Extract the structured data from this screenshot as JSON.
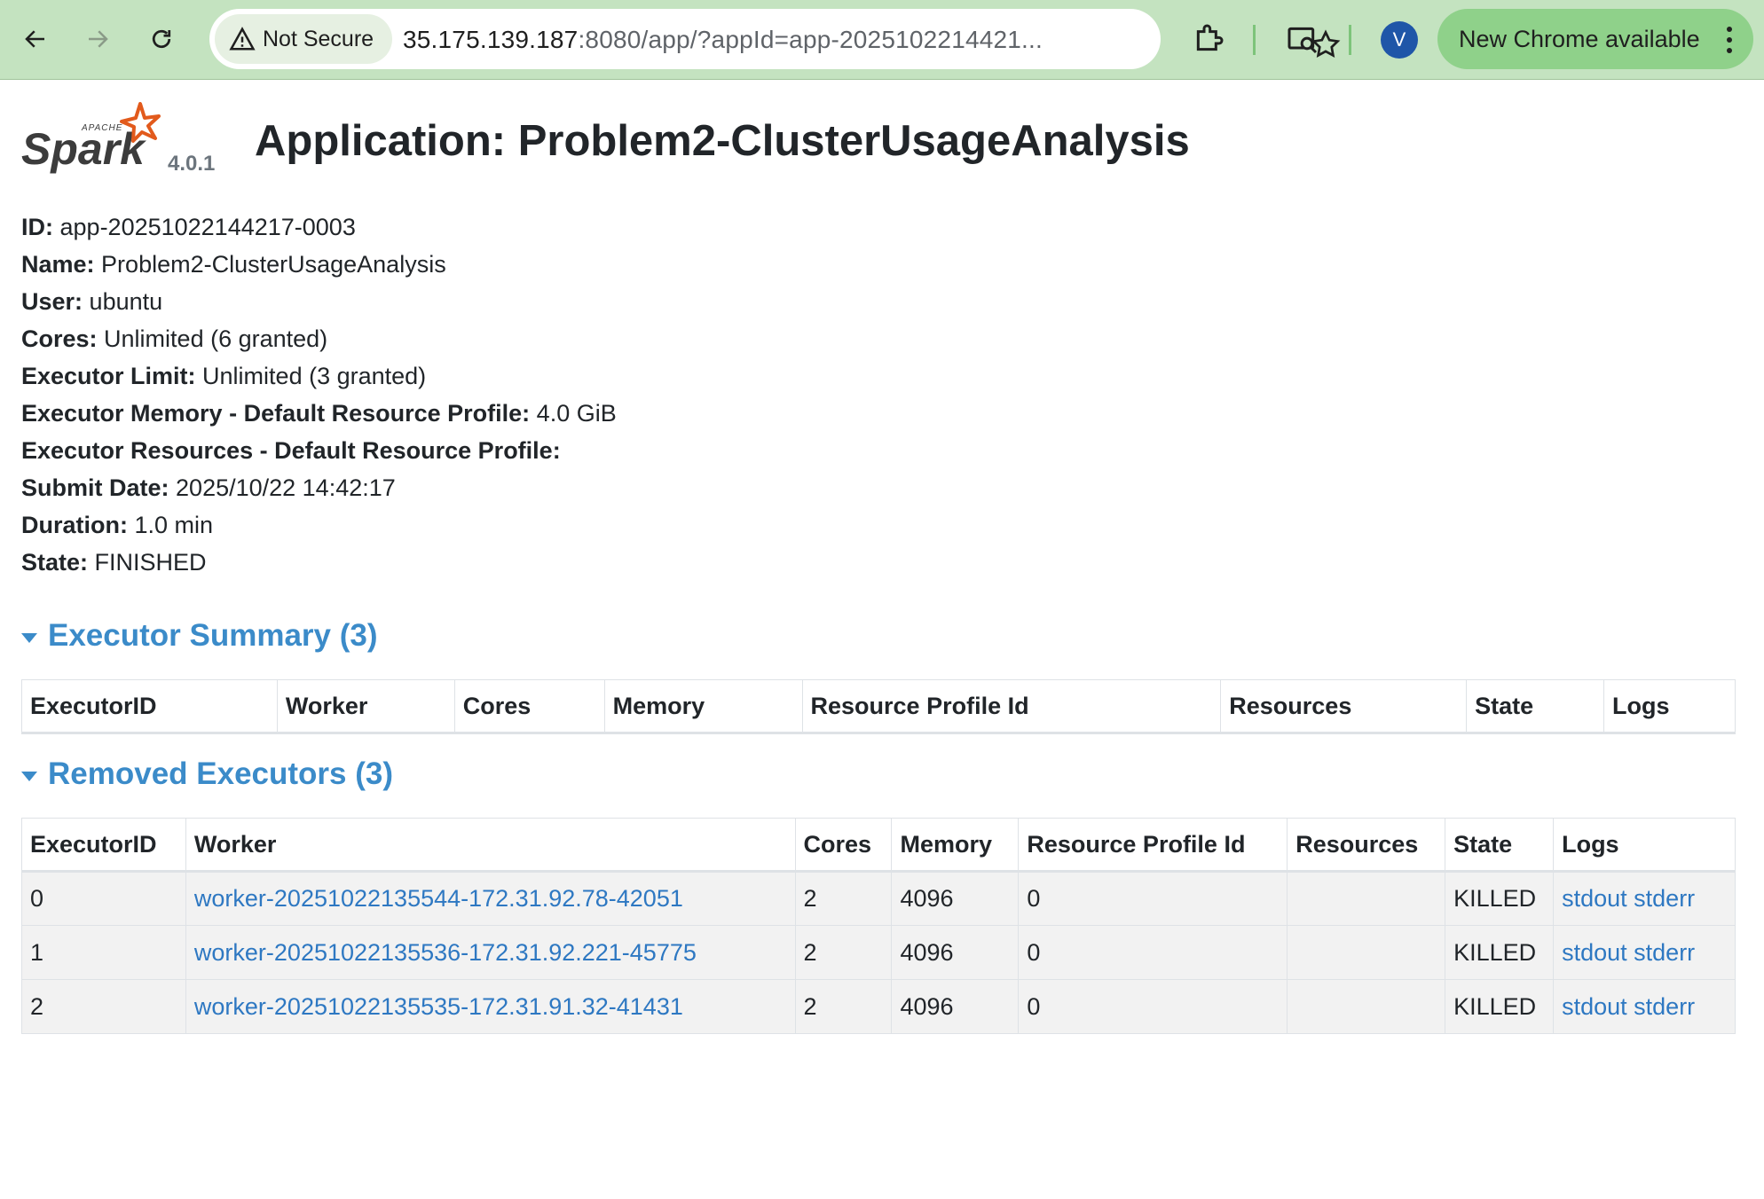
{
  "browser": {
    "security_label": "Not Secure",
    "url_host": "35.175.139.187",
    "url_rest": ":8080/app/?appId=app-2025102214421...",
    "avatar_initial": "V",
    "update_label": "New Chrome available"
  },
  "header": {
    "logo_text": "Spark",
    "logo_subtext": "APACHE",
    "version": "4.0.1",
    "title": "Application: Problem2-ClusterUsageAnalysis"
  },
  "info": [
    {
      "label": "ID:",
      "value": "app-20251022144217-0003"
    },
    {
      "label": "Name:",
      "value": "Problem2-ClusterUsageAnalysis"
    },
    {
      "label": "User:",
      "value": "ubuntu"
    },
    {
      "label": "Cores:",
      "value": "Unlimited (6 granted)"
    },
    {
      "label": "Executor Limit:",
      "value": "Unlimited (3 granted)"
    },
    {
      "label": "Executor Memory - Default Resource Profile:",
      "value": "4.0 GiB"
    },
    {
      "label": "Executor Resources - Default Resource Profile:",
      "value": ""
    },
    {
      "label": "Submit Date:",
      "value": "2025/10/22 14:42:17"
    },
    {
      "label": "Duration:",
      "value": "1.0 min"
    },
    {
      "label": "State:",
      "value": "FINISHED"
    }
  ],
  "executor_summary": {
    "title": "Executor Summary (3)",
    "columns": [
      "ExecutorID",
      "Worker",
      "Cores",
      "Memory",
      "Resource Profile Id",
      "Resources",
      "State",
      "Logs"
    ]
  },
  "removed_executors": {
    "title": "Removed Executors (3)",
    "columns": [
      "ExecutorID",
      "Worker",
      "Cores",
      "Memory",
      "Resource Profile Id",
      "Resources",
      "State",
      "Logs"
    ],
    "rows": [
      {
        "id": "0",
        "worker": "worker-20251022135544-172.31.92.78-42051",
        "cores": "2",
        "memory": "4096",
        "profile": "0",
        "resources": "",
        "state": "KILLED",
        "stdout": "stdout",
        "stderr": "stderr"
      },
      {
        "id": "1",
        "worker": "worker-20251022135536-172.31.92.221-45775",
        "cores": "2",
        "memory": "4096",
        "profile": "0",
        "resources": "",
        "state": "KILLED",
        "stdout": "stdout",
        "stderr": "stderr"
      },
      {
        "id": "2",
        "worker": "worker-20251022135535-172.31.91.32-41431",
        "cores": "2",
        "memory": "4096",
        "profile": "0",
        "resources": "",
        "state": "KILLED",
        "stdout": "stdout",
        "stderr": "stderr"
      }
    ]
  },
  "colors": {
    "toolbar": "#c4e3c0",
    "link": "#2e78c2",
    "section_header": "#3b8bc9",
    "spark_orange": "#e25a1c"
  }
}
